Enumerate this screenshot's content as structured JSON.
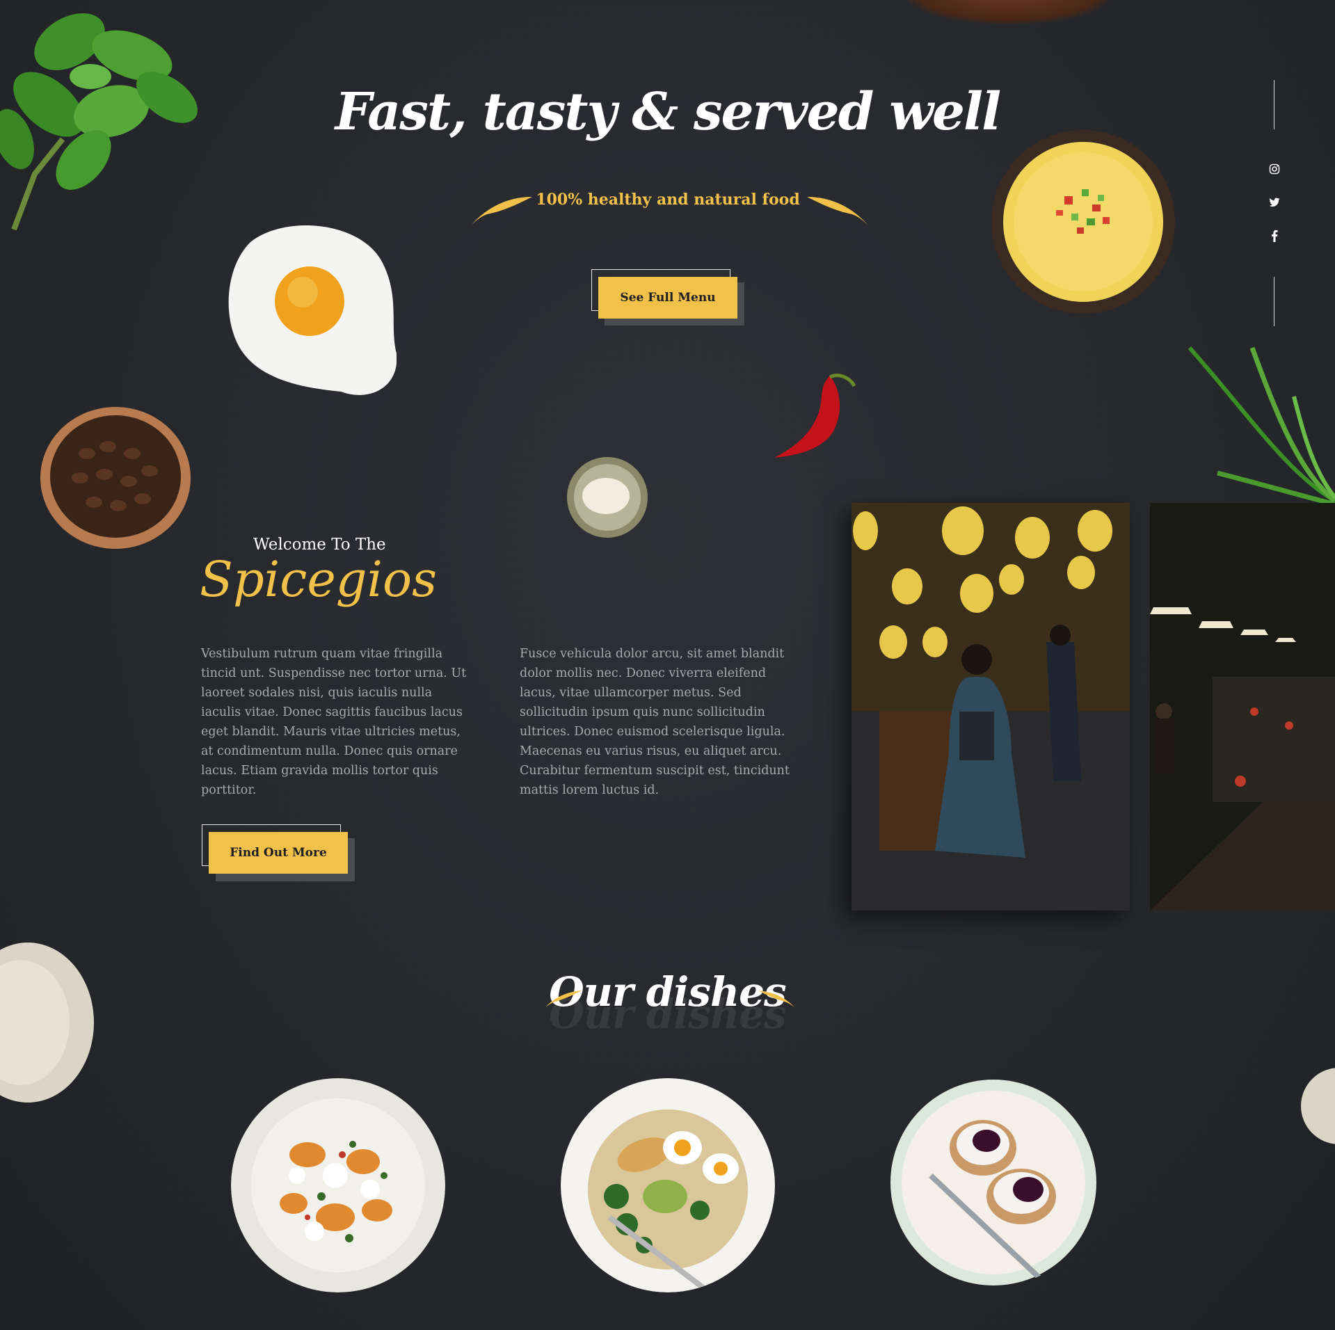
{
  "hero": {
    "title": "Fast, tasty & served well",
    "subtitle": "100% healthy and natural food",
    "menu_button": "See Full Menu"
  },
  "social": {
    "items": [
      {
        "icon": "instagram-icon"
      },
      {
        "icon": "twitter-icon"
      },
      {
        "icon": "facebook-icon"
      }
    ]
  },
  "welcome": {
    "pre": "Welcome To The",
    "brand": "Spicegios",
    "paragraph_1": "Vestibulum rutrum quam vitae fringilla tincid unt. Suspendisse nec tortor urna. Ut laoreet sodales nisi, quis iaculis nulla iaculis vitae. Donec sagittis faucibus lacus eget blandit. Mauris vitae ultricies metus, at condimentum nulla. Donec quis ornare lacus. Etiam gravida mollis tortor quis porttitor.",
    "paragraph_2": "Fusce vehicula dolor arcu, sit amet blandit dolor mollis nec. Donec viverra eleifend lacus, vitae ullamcorper metus. Sed sollicitudin ipsum quis nunc sollicitudin ultrices. Donec euismod scelerisque ligula. Maecenas eu varius risus, eu aliquet arcu. Curabitur fermentum suscipit est, tincidunt mattis lorem luctus id.",
    "button": "Find Out More"
  },
  "dishes": {
    "title": "Our dishes"
  },
  "colors": {
    "accent": "#f2c14a",
    "background": "#26282c",
    "body_text": "#a7a9ac"
  }
}
